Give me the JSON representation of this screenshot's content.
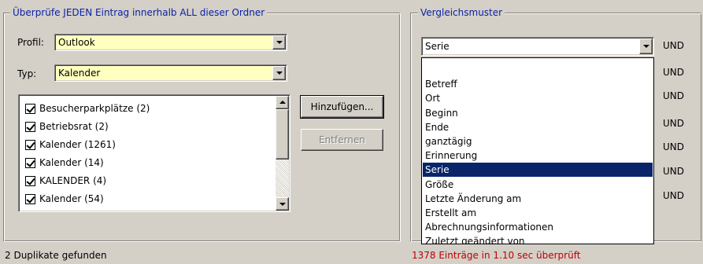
{
  "left_group": {
    "legend": "Überprüfe JEDEN Eintrag innerhalb ALL dieser Ordner",
    "profil_label": "Profil:",
    "profil_value": "Outlook",
    "typ_label": "Typ:",
    "typ_value": "Kalender",
    "folders": [
      {
        "label": "Besucherparkplätze (2)",
        "checked": true
      },
      {
        "label": "Betriebsrat (2)",
        "checked": true
      },
      {
        "label": "Kalender (1261)",
        "checked": true
      },
      {
        "label": "Kalender (14)",
        "checked": true
      },
      {
        "label": "KALENDER (4)",
        "checked": true
      },
      {
        "label": "Kalender (54)",
        "checked": true
      }
    ],
    "add_button": "Hinzufügen...",
    "remove_button": "Entfernen"
  },
  "right_group": {
    "legend": "Vergleichsmuster",
    "combo_value": "Serie",
    "und_labels": [
      "UND",
      "UND",
      "UND",
      "UND",
      "UND",
      "UND",
      "UND"
    ],
    "dropdown_options": [
      {
        "label": "",
        "selected": false
      },
      {
        "label": "Betreff",
        "selected": false
      },
      {
        "label": "Ort",
        "selected": false
      },
      {
        "label": "Beginn",
        "selected": false
      },
      {
        "label": "Ende",
        "selected": false
      },
      {
        "label": "ganztägig",
        "selected": false
      },
      {
        "label": "Erinnerung",
        "selected": false
      },
      {
        "label": "Serie",
        "selected": true
      },
      {
        "label": "Größe",
        "selected": false
      },
      {
        "label": "Letzte Änderung am",
        "selected": false
      },
      {
        "label": "Erstellt am",
        "selected": false
      },
      {
        "label": "Abrechnungsinformationen",
        "selected": false
      },
      {
        "label": "Zuletzt geändert von",
        "selected": false
      }
    ]
  },
  "status": {
    "left": "2 Duplikate gefunden",
    "right": "1378 Einträge in 1.10 sec überprüft",
    "right_color": "#c00000"
  },
  "colors": {
    "window_bg": "#d4d0c8",
    "legend_text": "#0b22a8",
    "combo_bg_yellow": "#ffffc0",
    "selection": "#0a246a"
  }
}
